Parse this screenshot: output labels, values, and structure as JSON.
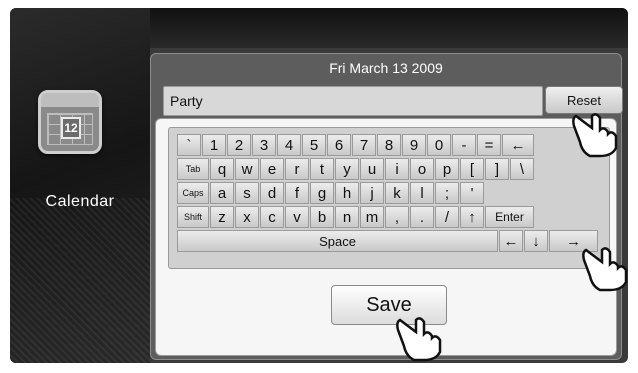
{
  "sidebar": {
    "app_icon_number": "12",
    "app_label": "Calendar"
  },
  "panel": {
    "date": "Fri March 13 2009",
    "event_field_value": "Party",
    "reset_label": "Reset",
    "save_label": "Save"
  },
  "keyboard": {
    "row1": [
      "`",
      "1",
      "2",
      "3",
      "4",
      "5",
      "6",
      "7",
      "8",
      "9",
      "0",
      "-",
      "=",
      "←"
    ],
    "row2": [
      "Tab",
      "q",
      "w",
      "e",
      "r",
      "t",
      "y",
      "u",
      "i",
      "o",
      "p",
      "[",
      "]",
      "\\"
    ],
    "row3": [
      "Caps",
      "a",
      "s",
      "d",
      "f",
      "g",
      "h",
      "j",
      "k",
      "l",
      ";",
      "'"
    ],
    "row4": [
      "Shift",
      "z",
      "x",
      "c",
      "v",
      "b",
      "n",
      "m",
      ",",
      ".",
      "/",
      "↑",
      "Enter"
    ],
    "row5": [
      "Space",
      "←",
      "↓",
      "→"
    ]
  }
}
